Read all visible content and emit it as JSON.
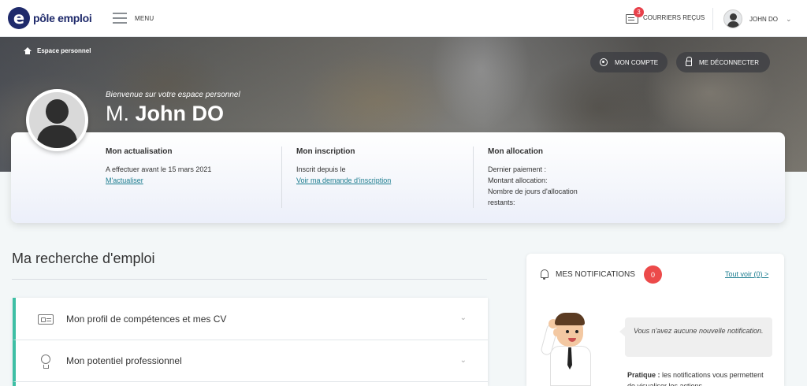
{
  "header": {
    "logo_text": "pôle emploi",
    "menu_label": "MENU",
    "mail_label": "COURRIERS REÇUS",
    "mail_count": "3",
    "user_name": "JOHN DO"
  },
  "hero": {
    "breadcrumb": "Espace personnel",
    "account_button": "MON COMPTE",
    "logout_button": "ME DÉCONNECTER",
    "welcome": "Bienvenue sur votre espace personnel",
    "civility": "M.",
    "name": "John DO"
  },
  "summary": {
    "actualisation": {
      "title": "Mon actualisation",
      "text": "A effectuer avant le 15 mars 2021",
      "link": "M'actualiser"
    },
    "inscription": {
      "title": "Mon inscription",
      "text": "Inscrit depuis le",
      "link": "Voir ma demande d'inscription"
    },
    "allocation": {
      "title": "Mon allocation",
      "line1": "Dernier paiement :",
      "line2": "Montant allocation:",
      "line3": "Nombre de jours d'allocation",
      "line4": "restants:"
    }
  },
  "main": {
    "title": "Ma recherche d'emploi",
    "items": [
      {
        "label": "Mon profil de compétences et mes CV",
        "icon": "id-card-icon"
      },
      {
        "label": "Mon potentiel professionnel",
        "icon": "lightbulb-icon"
      }
    ]
  },
  "notifications": {
    "title": "MES NOTIFICATIONS",
    "count": "0",
    "see_all": "Tout voir (0) >",
    "empty_message": "Vous n'avez aucune nouvelle notification.",
    "tip_label": "Pratique :",
    "tip_text": "les notifications vous permettent de visualiser les actions"
  },
  "colors": {
    "brand": "#1f2a6b",
    "accent_green": "#3ebfa5",
    "link": "#1b7c8f",
    "badge_red": "#ec4a4a"
  }
}
